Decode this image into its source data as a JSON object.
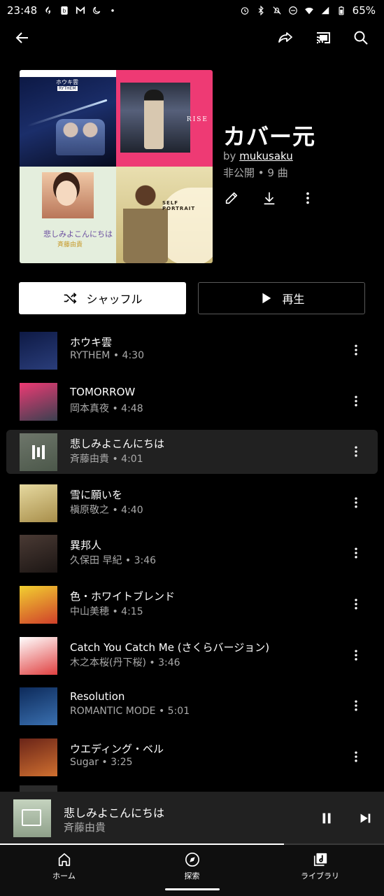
{
  "status_bar": {
    "time": "23:48",
    "battery": "65%",
    "left_icons": [
      "flame-icon",
      "b-badge-icon",
      "gmail-icon",
      "moon-icon",
      "dot-icon"
    ],
    "right_icons": [
      "alarm-icon",
      "bluetooth-icon",
      "mute-icon",
      "dnd-icon",
      "wifi-icon",
      "signal-icon",
      "battery-icon"
    ]
  },
  "appbar": {
    "icons": [
      "back-arrow-icon",
      "share-icon",
      "cast-icon",
      "search-icon"
    ]
  },
  "playlist": {
    "title": "カバー元",
    "by_prefix": "by",
    "owner": "mukusaku",
    "meta": "非公開 • 9 曲",
    "actions": [
      "edit-icon",
      "download-icon",
      "more-vert-icon"
    ],
    "cover_text": {
      "tile1": "ホウキ雲",
      "tile1b": "RYTHEM",
      "tile2": "RISE",
      "tile3": "悲しみよこんにちは",
      "tile3b": "斉藤由貴",
      "tile4": "SELF PORTRAIT"
    }
  },
  "buttons": {
    "shuffle": "シャッフル",
    "play": "再生"
  },
  "tracks": [
    {
      "title": "ホウキ雲",
      "subtitle": "RYTHEM • 4:30",
      "active": false,
      "thumb": [
        "#0e1a45",
        "#2a3d7a"
      ]
    },
    {
      "title": "TOMORROW",
      "subtitle": "岡本真夜 • 4:48",
      "active": false,
      "thumb": [
        "#ee3a74",
        "#3a4050"
      ]
    },
    {
      "title": "悲しみよこんにちは",
      "subtitle": "斉藤由貴 • 4:01",
      "active": true,
      "thumb": [
        "#c8d7c2",
        "#8aa087"
      ]
    },
    {
      "title": "雪に願いを",
      "subtitle": "槇原敬之 • 4:40",
      "active": false,
      "thumb": [
        "#e6d9a0",
        "#a88e4a"
      ]
    },
    {
      "title": "異邦人",
      "subtitle": "久保田 早紀 • 3:46",
      "active": false,
      "thumb": [
        "#4a3a34",
        "#1c1614"
      ]
    },
    {
      "title": "色・ホワイトブレンド",
      "subtitle": "中山美穂 • 4:15",
      "active": false,
      "thumb": [
        "#f2d030",
        "#d0402a"
      ]
    },
    {
      "title": "Catch You Catch Me (さくらバージョン)",
      "subtitle": "木之本桜(丹下桜) • 3:46",
      "active": false,
      "thumb": [
        "#ffffff",
        "#e04040"
      ]
    },
    {
      "title": "Resolution",
      "subtitle": "ROMANTIC MODE • 5:01",
      "active": false,
      "thumb": [
        "#0d2a5a",
        "#3a70b0"
      ]
    },
    {
      "title": "ウエディング・ベル",
      "subtitle": "Sugar • 3:25",
      "active": false,
      "thumb": [
        "#6a2418",
        "#d07030"
      ]
    }
  ],
  "now_playing": {
    "title": "悲しみよこんにちは",
    "artist": "斉藤由貴",
    "progress": 0.74
  },
  "nav": [
    {
      "label": "ホーム",
      "icon": "home-icon",
      "selected": false
    },
    {
      "label": "探索",
      "icon": "compass-icon",
      "selected": true
    },
    {
      "label": "ライブラリ",
      "icon": "library-music-icon",
      "selected": false
    }
  ]
}
